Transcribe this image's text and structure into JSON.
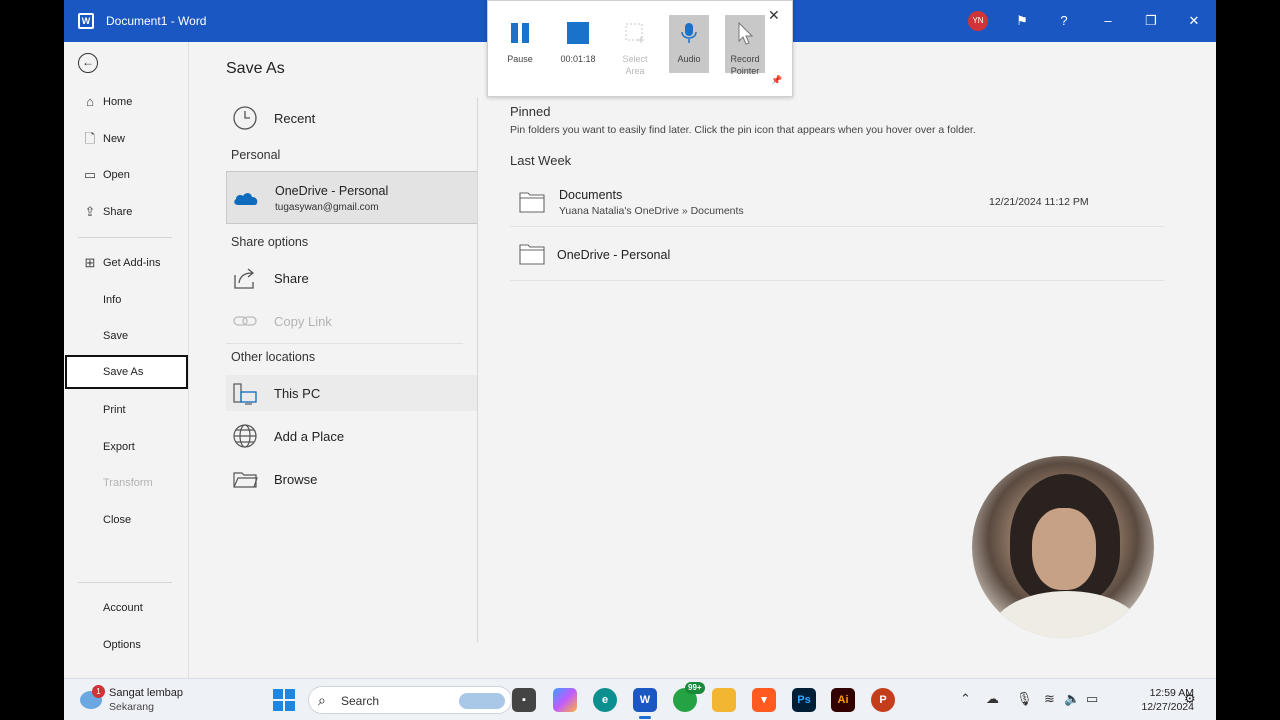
{
  "window": {
    "title": "Document1  -  Word",
    "app_icon": "word-icon",
    "user_initials": "YN",
    "avatar_color": "#d13438",
    "accent": "#1a57c2"
  },
  "nav": {
    "items": [
      {
        "label": "Home",
        "icon": "home-icon"
      },
      {
        "label": "New",
        "icon": "new-document-icon"
      },
      {
        "label": "Open",
        "icon": "open-folder-icon"
      },
      {
        "label": "Share",
        "icon": "share-icon"
      },
      {
        "label": "Get Add-ins",
        "icon": "add-ins-icon"
      },
      {
        "label": "Info"
      },
      {
        "label": "Save"
      },
      {
        "label": "Save As",
        "selected": true
      },
      {
        "label": "Print"
      },
      {
        "label": "Export"
      },
      {
        "label": "Transform",
        "disabled": true
      },
      {
        "label": "Close"
      },
      {
        "label": "Account"
      },
      {
        "label": "Options"
      }
    ]
  },
  "save_as": {
    "heading": "Save As",
    "recent_label": "Recent",
    "personal_section": "Personal",
    "onedrive": {
      "name": "OneDrive - Personal",
      "email": "tugasywan@gmail.com"
    },
    "share_options_section": "Share options",
    "share_label": "Share",
    "copy_link_label": "Copy Link",
    "other_locations_section": "Other locations",
    "this_pc_label": "This PC",
    "add_place_label": "Add a Place",
    "browse_label": "Browse"
  },
  "recorder": {
    "pause_label": "Pause",
    "timer": "00:01:18",
    "select_area_label": "Select\nArea",
    "audio_label": "Audio",
    "record_pointer_label": "Record\nPointer"
  },
  "right": {
    "pinned_heading": "Pinned",
    "pinned_hint": "Pin folders you want to easily find later. Click the pin icon that appears when you hover over a folder.",
    "last_week_heading": "Last Week",
    "folders": [
      {
        "name": "Documents",
        "path": "Yuana Natalia's OneDrive » Documents",
        "date": "12/21/2024 11:12 PM"
      },
      {
        "name": "OneDrive - Personal",
        "path": "",
        "date": ""
      }
    ]
  },
  "taskbar": {
    "weather_line1": "Sangat lembap",
    "weather_line2": "Sekarang",
    "weather_badge": "1",
    "search_placeholder": "Search",
    "whatsapp_badge": "99+",
    "time": "12:59 AM",
    "date": "12/27/2024"
  }
}
